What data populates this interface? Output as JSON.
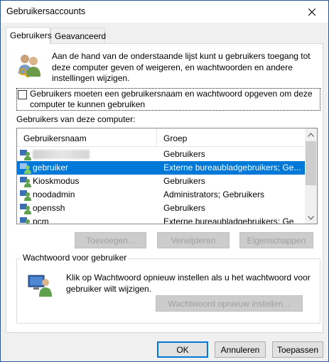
{
  "window": {
    "title": "Gebruikersaccounts"
  },
  "tabs": [
    {
      "label": "Gebruikers",
      "active": true
    },
    {
      "label": "Geavanceerd",
      "active": false
    }
  ],
  "intro_text": "Aan de hand van de onderstaande lijst kunt u gebruikers toegang tot deze computer geven of weigeren, en wachtwoorden en andere instellingen wijzigen.",
  "checkbox": {
    "label": "Gebruikers moeten een gebruikersnaam en wachtwoord opgeven om deze computer te kunnen gebruiken",
    "checked": false
  },
  "users_caption": "Gebruikers van deze computer:",
  "list": {
    "columns": [
      "Gebruikersnaam",
      "Groep"
    ],
    "rows": [
      {
        "name": "",
        "group": "Gebruikers",
        "redacted": true,
        "selected": false
      },
      {
        "name": "gebruiker",
        "group": "Externe bureaubladgebruikers; Ge...",
        "selected": true
      },
      {
        "name": "Kioskmodus",
        "group": "Gebruikers",
        "selected": false
      },
      {
        "name": "noodadmin",
        "group": "Administrators; Gebruikers",
        "selected": false
      },
      {
        "name": "openssh",
        "group": "Gebruikers",
        "selected": false
      },
      {
        "name": "pcm",
        "group": "Externe bureaubladgebruikers; Ge",
        "selected": false
      }
    ]
  },
  "list_buttons": {
    "add": "Toevoegen...",
    "remove": "Verwijderen",
    "properties": "Eigenschappen"
  },
  "password_group": {
    "title": "Wachtwoord voor gebruiker",
    "text": "Klik op Wachtwoord opnieuw instellen als u het wachtwoord voor gebruiker wilt wijzigen.",
    "reset_button": "Wachtwoord opnieuw instellen..."
  },
  "dialog_buttons": {
    "ok": "OK",
    "cancel": "Annuleren",
    "apply": "Toepassen"
  },
  "colors": {
    "selection": "#0078d7",
    "default_button_border": "#0078d7"
  }
}
